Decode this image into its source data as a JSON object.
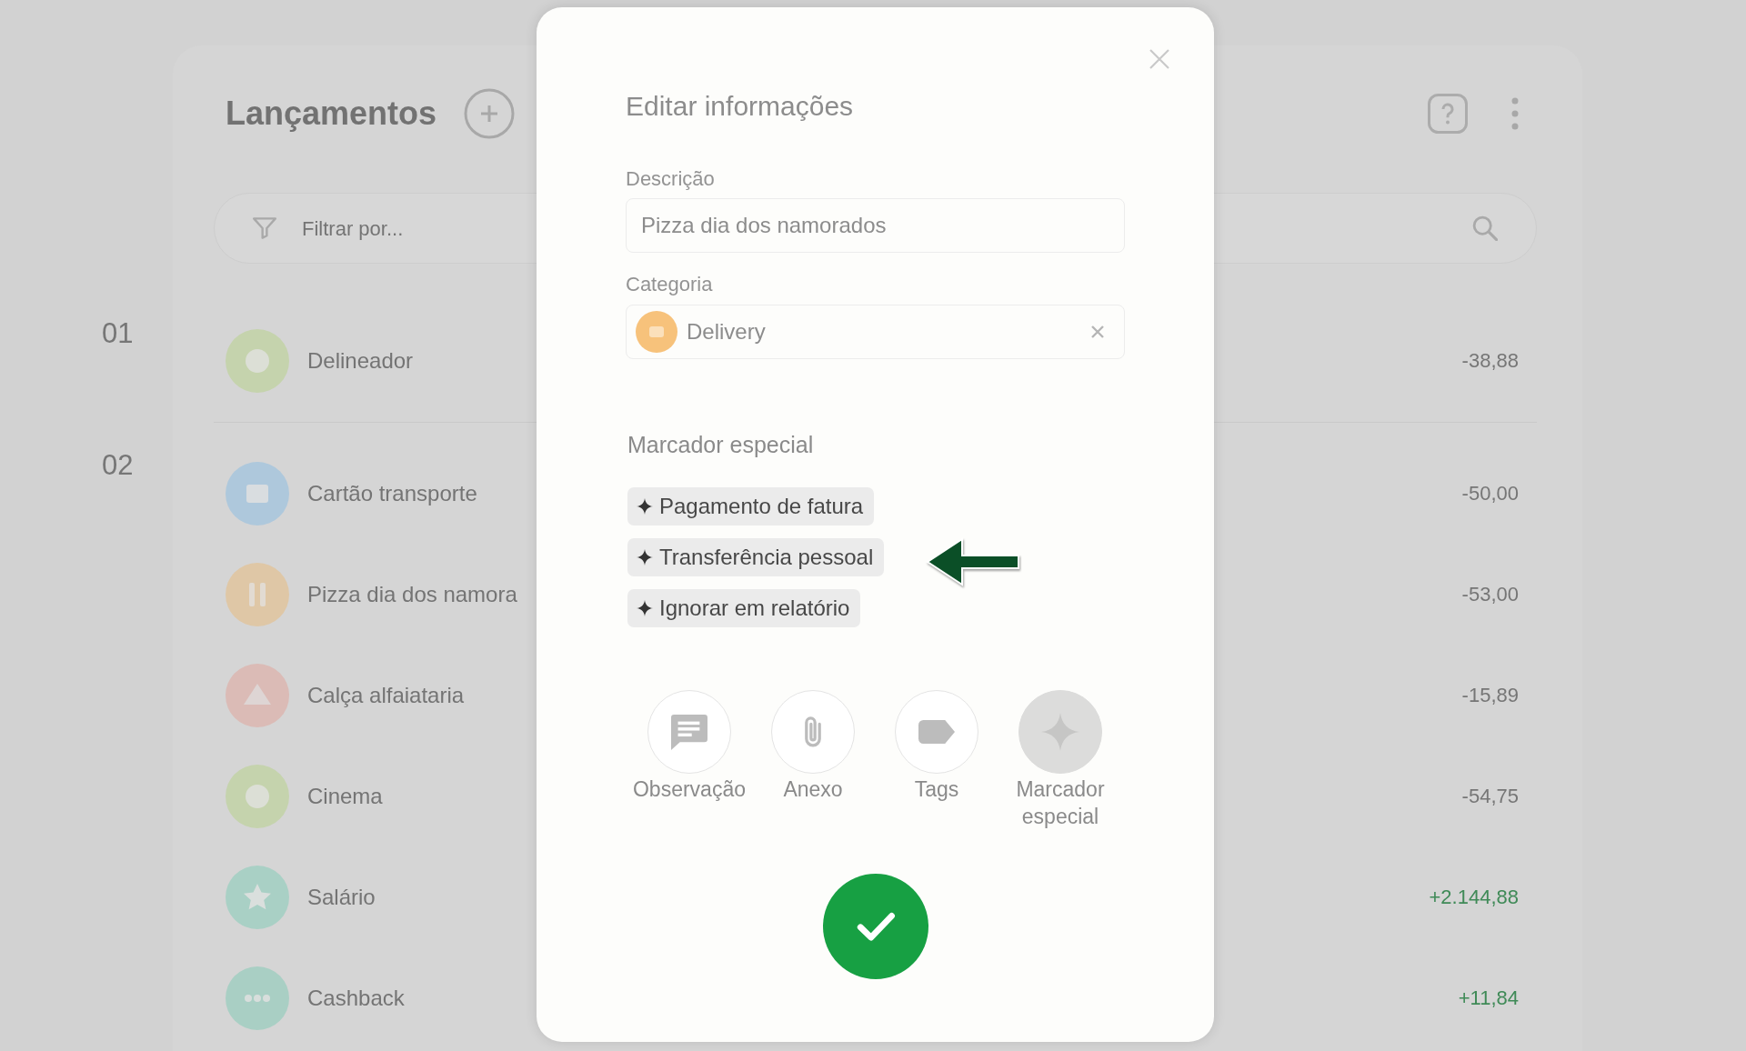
{
  "background_page": {
    "title": "Lançamentos",
    "filter": {
      "placeholder": "Filtrar por..."
    },
    "groups": [
      {
        "label": "01",
        "rows": [
          {
            "kind": "ring",
            "color": "#c5d3ad",
            "name": "Delineador",
            "amount": "-38,88",
            "income": false
          }
        ]
      },
      {
        "label": "02",
        "rows": [
          {
            "kind": "card",
            "color": "#aec8dc",
            "name": "Cartão transporte",
            "amount": "-50,00",
            "income": false
          },
          {
            "kind": "cutlery",
            "color": "#dfc7a6",
            "name": "Pizza dia dos namora",
            "amount": "-53,00",
            "income": false
          },
          {
            "kind": "hanger",
            "color": "#dbbbb6",
            "name": "Calça alfaiataria",
            "amount": "-15,89",
            "income": false
          },
          {
            "kind": "ring",
            "color": "#c5d3ad",
            "name": "Cinema",
            "amount": "-54,75",
            "income": false
          },
          {
            "kind": "star",
            "color": "#a9d0c5",
            "name": "Salário",
            "amount": "+2.144,88",
            "income": true
          },
          {
            "kind": "dots",
            "color": "#a9cfc4",
            "name": "Cashback",
            "amount": "+11,84",
            "income": true
          }
        ]
      }
    ]
  },
  "dialog": {
    "title": "Editar informações",
    "description": {
      "label": "Descrição",
      "value": "Pizza dia dos namorados"
    },
    "category": {
      "label": "Categoria",
      "value": "Delivery"
    },
    "special_marker": {
      "heading": "Marcador especial",
      "options": [
        {
          "label": "Pagamento de fatura",
          "pointed_at": false
        },
        {
          "label": "Transferência pessoal",
          "pointed_at": true
        },
        {
          "label": "Ignorar em relatório",
          "pointed_at": false
        }
      ]
    },
    "actions": [
      {
        "kind": "note",
        "label": "Observação",
        "selected": false
      },
      {
        "kind": "clip",
        "label": "Anexo",
        "selected": false
      },
      {
        "kind": "tag",
        "label": "Tags",
        "selected": false
      },
      {
        "kind": "sparkle",
        "label": "Marcador especial",
        "selected": true
      }
    ]
  }
}
